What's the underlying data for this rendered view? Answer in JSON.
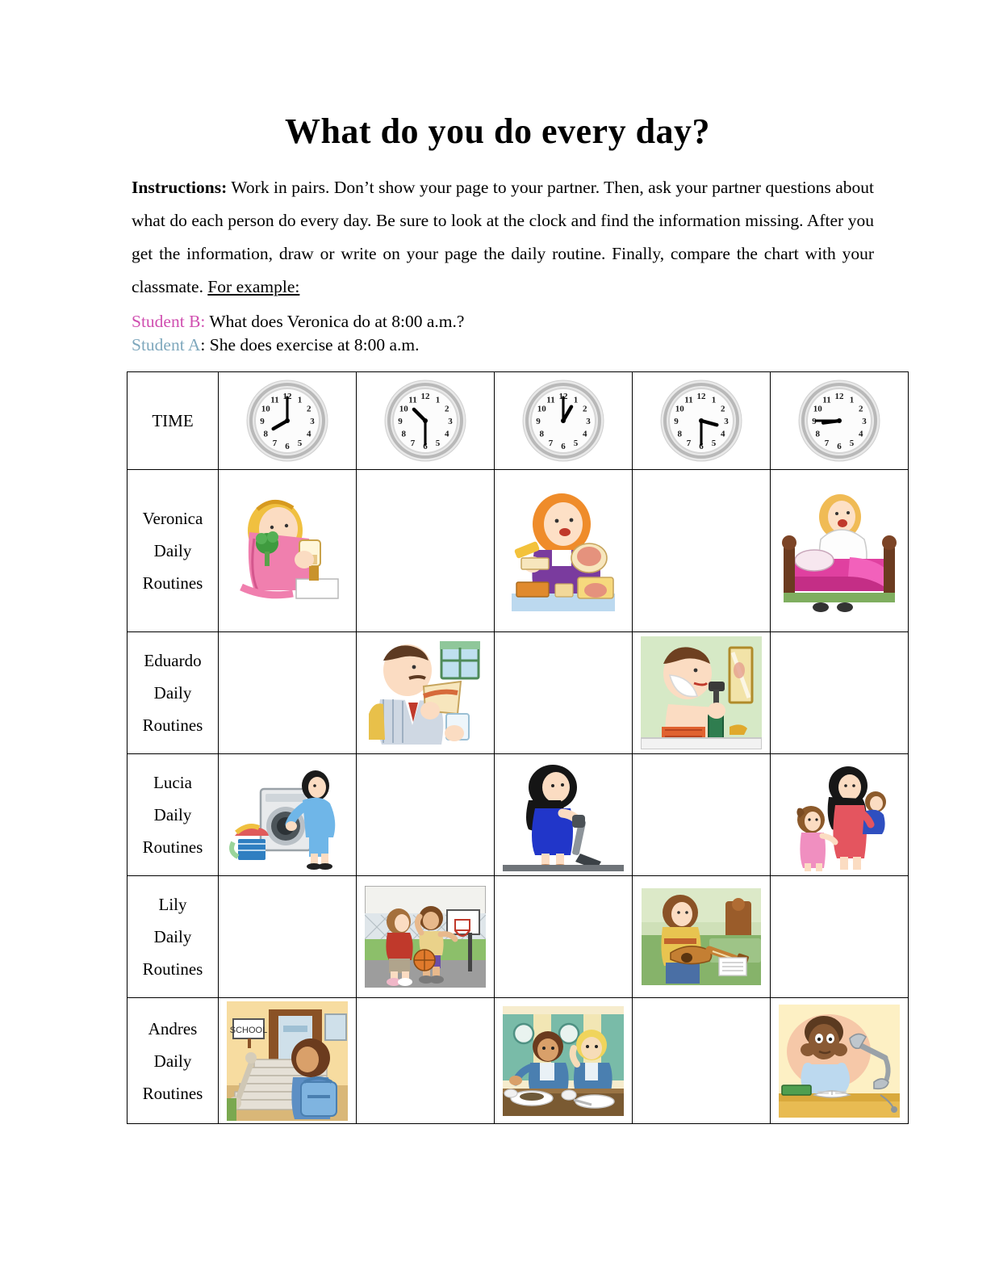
{
  "worksheet": {
    "title": "What do you do every day?",
    "instructions_label": "Instructions:",
    "instructions_body": " Work in pairs. Don’t show your page to your partner.  Then, ask your partner questions about what do each person do every day. Be sure to look at the clock and find the information missing. After you get the information, draw or write on your page the daily routine. Finally, compare the chart with your classmate. ",
    "for_example": "For example:",
    "example": {
      "student_b_label": "Student B:",
      "student_b_text": " What does Veronica do at 8:00 a.m.?",
      "student_a_label": "Student A",
      "student_a_text": ": She does exercise at 8:00 a.m.",
      "student_b_color": "#d04fb0",
      "student_a_color": "#7fa8bd"
    }
  },
  "table": {
    "row_labels": [
      "TIME",
      [
        "Veronica",
        "Daily",
        "Routines"
      ],
      [
        "Eduardo",
        "Daily",
        "Routines"
      ],
      [
        "Lucia",
        "Daily",
        "Routines"
      ],
      [
        "Lily",
        "Daily",
        "Routines"
      ],
      [
        "Andres",
        "Daily",
        "Routines"
      ]
    ],
    "times": [
      {
        "label": "8:00",
        "hour": 8,
        "minute": 0
      },
      {
        "label": "10:30",
        "hour": 10,
        "minute": 30
      },
      {
        "label": "1:00",
        "hour": 1,
        "minute": 0
      },
      {
        "label": "3:30",
        "hour": 3,
        "minute": 30
      },
      {
        "label": "8:45",
        "hour": 8,
        "minute": 45
      }
    ],
    "clock_numerals": [
      "12",
      "1",
      "2",
      "3",
      "4",
      "5",
      "6",
      "7",
      "8",
      "9",
      "10",
      "11"
    ],
    "rows": [
      {
        "person": "Veronica",
        "cells": [
          {
            "filled": true,
            "icon": "woman-eating-vegetables-picture",
            "caption": "woman in pink eating broccoli and drinking"
          },
          {
            "filled": false,
            "icon": "empty-cell",
            "caption": ""
          },
          {
            "filled": true,
            "icon": "woman-making-sandwich-picture",
            "caption": "woman in purple making a sandwich"
          },
          {
            "filled": false,
            "icon": "empty-cell",
            "caption": ""
          },
          {
            "filled": true,
            "icon": "woman-waking-up-in-bed-picture",
            "caption": "woman sitting up in bed waking up"
          }
        ]
      },
      {
        "person": "Eduardo",
        "cells": [
          {
            "filled": false,
            "icon": "empty-cell",
            "caption": ""
          },
          {
            "filled": true,
            "icon": "man-eating-sandwich-picture",
            "caption": "man with moustache eating a sandwich by a window"
          },
          {
            "filled": false,
            "icon": "empty-cell",
            "caption": ""
          },
          {
            "filled": true,
            "icon": "man-shaving-picture",
            "caption": "man shaving in front of a mirror"
          },
          {
            "filled": false,
            "icon": "empty-cell",
            "caption": ""
          }
        ]
      },
      {
        "person": "Lucia",
        "cells": [
          {
            "filled": true,
            "icon": "woman-doing-laundry-picture",
            "caption": "woman loading a washing machine"
          },
          {
            "filled": false,
            "icon": "empty-cell",
            "caption": ""
          },
          {
            "filled": true,
            "icon": "woman-vacuuming-picture",
            "caption": "woman in blue dress vacuuming"
          },
          {
            "filled": false,
            "icon": "empty-cell",
            "caption": ""
          },
          {
            "filled": true,
            "icon": "mother-with-children-picture",
            "caption": "mother in red dress with two children"
          }
        ]
      },
      {
        "person": "Lily",
        "cells": [
          {
            "filled": false,
            "icon": "empty-cell",
            "caption": ""
          },
          {
            "filled": true,
            "icon": "children-playing-basketball-picture",
            "caption": "two children playing basketball outdoors"
          },
          {
            "filled": false,
            "icon": "empty-cell",
            "caption": ""
          },
          {
            "filled": true,
            "icon": "girl-playing-guitar-picture",
            "caption": "girl playing guitar on a green sofa"
          },
          {
            "filled": false,
            "icon": "empty-cell",
            "caption": ""
          }
        ]
      },
      {
        "person": "Andres",
        "cells": [
          {
            "filled": true,
            "icon": "boy-going-to-school-picture",
            "caption": "boy with backpack entering school steps"
          },
          {
            "filled": false,
            "icon": "empty-cell",
            "caption": ""
          },
          {
            "filled": true,
            "icon": "children-eating-dinner-picture",
            "caption": "boy and girl eating at a dinner table"
          },
          {
            "filled": false,
            "icon": "empty-cell",
            "caption": ""
          },
          {
            "filled": true,
            "icon": "boy-studying-at-desk-picture",
            "caption": "boy studying at a desk with book and lamp"
          }
        ]
      }
    ]
  }
}
